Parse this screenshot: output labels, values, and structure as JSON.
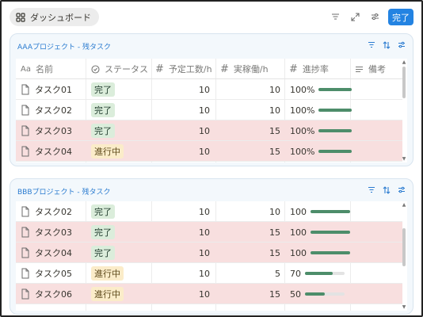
{
  "topbar": {
    "dashboard_label": "ダッシュボード",
    "done_label": "完了",
    "icons": [
      "filter-icon",
      "expand-icon",
      "sliders-icon"
    ]
  },
  "panels": [
    {
      "title": "AAAプロジェクト - 残タスク",
      "columns": [
        "名前",
        "ステータス",
        "予定工数/h",
        "実稼働/h",
        "進捗率",
        "備考"
      ],
      "rows": [
        {
          "name": "タスク01",
          "status": "完了",
          "plan": "10",
          "actual": "10",
          "progress": "100%",
          "progress_value": 1.0,
          "highlight": false
        },
        {
          "name": "タスク02",
          "status": "完了",
          "plan": "10",
          "actual": "10",
          "progress": "100%",
          "progress_value": 1.0,
          "highlight": false
        },
        {
          "name": "タスク03",
          "status": "完了",
          "plan": "10",
          "actual": "15",
          "progress": "100%",
          "progress_value": 1.0,
          "highlight": true
        },
        {
          "name": "タスク04",
          "status": "進行中",
          "plan": "10",
          "actual": "15",
          "progress": "100%",
          "progress_value": 1.0,
          "highlight": true
        }
      ]
    },
    {
      "title": "BBBプロジェクト - 残タスク",
      "rows": [
        {
          "name": "タスク02",
          "status": "完了",
          "plan": "10",
          "actual": "10",
          "progress": "100",
          "progress_value": 1.0,
          "highlight": false
        },
        {
          "name": "タスク03",
          "status": "完了",
          "plan": "10",
          "actual": "15",
          "progress": "100",
          "progress_value": 1.0,
          "highlight": true
        },
        {
          "name": "タスク04",
          "status": "完了",
          "plan": "10",
          "actual": "15",
          "progress": "100",
          "progress_value": 1.0,
          "highlight": true
        },
        {
          "name": "タスク05",
          "status": "進行中",
          "plan": "10",
          "actual": "5",
          "progress": "70",
          "progress_value": 0.7,
          "highlight": false
        },
        {
          "name": "タスク06",
          "status": "進行中",
          "plan": "10",
          "actual": "15",
          "progress": "50",
          "progress_value": 0.5,
          "highlight": true
        }
      ]
    }
  ],
  "colors": {
    "accent": "#2383e2",
    "highlight_row": "#f8dfdf",
    "done_badge": "#dbeddb",
    "in_progress_badge": "#fbecc9",
    "progress_bar": "#4d8d6a"
  }
}
